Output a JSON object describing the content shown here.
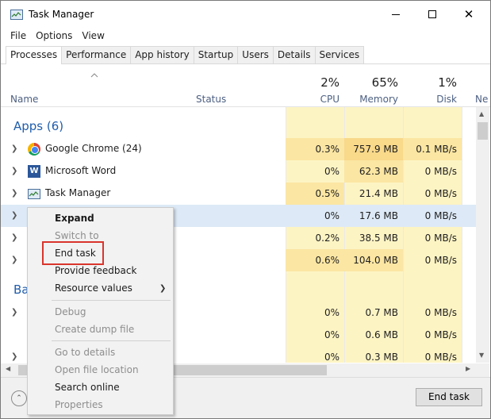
{
  "window": {
    "title": "Task Manager"
  },
  "menu": [
    "File",
    "Options",
    "View"
  ],
  "tabs": [
    "Processes",
    "Performance",
    "App history",
    "Startup",
    "Users",
    "Details",
    "Services"
  ],
  "columns": {
    "name": "Name",
    "status": "Status",
    "cpu": {
      "pct": "2%",
      "label": "CPU"
    },
    "memory": {
      "pct": "65%",
      "label": "Memory"
    },
    "disk": {
      "pct": "1%",
      "label": "Disk"
    },
    "network_partial": "Ne"
  },
  "groups": {
    "apps": "Apps (6)",
    "background_partial": "Ba"
  },
  "rows": [
    {
      "name": "Google Chrome (24)",
      "cpu": "0.3%",
      "mem": "757.9 MB",
      "disk": "0.1 MB/s",
      "icon": "chrome-icon"
    },
    {
      "name": "Microsoft Word",
      "cpu": "0%",
      "mem": "62.3 MB",
      "disk": "0 MB/s",
      "icon": "word-icon"
    },
    {
      "name": "Task Manager",
      "cpu": "0.5%",
      "mem": "21.4 MB",
      "disk": "0 MB/s",
      "icon": "task-manager-icon"
    },
    {
      "name": "",
      "cpu": "0%",
      "mem": "17.6 MB",
      "disk": "0 MB/s"
    },
    {
      "name": "",
      "cpu": "0.2%",
      "mem": "38.5 MB",
      "disk": "0 MB/s"
    },
    {
      "name": "",
      "cpu": "0.6%",
      "mem": "104.0 MB",
      "disk": "0 MB/s"
    },
    {
      "name": "",
      "cpu": "0%",
      "mem": "0.7 MB",
      "disk": "0 MB/s"
    },
    {
      "name": "",
      "cpu": "0%",
      "mem": "0.6 MB",
      "disk": "0 MB/s"
    },
    {
      "name": "",
      "cpu": "0%",
      "mem": "0.3 MB",
      "disk": "0 MB/s"
    }
  ],
  "context_menu": {
    "expand": "Expand",
    "switch_to": "Switch to",
    "end_task": "End task",
    "provide_feedback": "Provide feedback",
    "resource_values": "Resource values",
    "debug": "Debug",
    "create_dump_file": "Create dump file",
    "go_to_details": "Go to details",
    "open_file_location": "Open file location",
    "search_online": "Search online",
    "properties": "Properties"
  },
  "footer": {
    "end_task_button": "End task"
  },
  "colors": {
    "accent": "#1f5dac",
    "highlight": "#d9352d",
    "resource_bg": "#fdf4c4"
  }
}
